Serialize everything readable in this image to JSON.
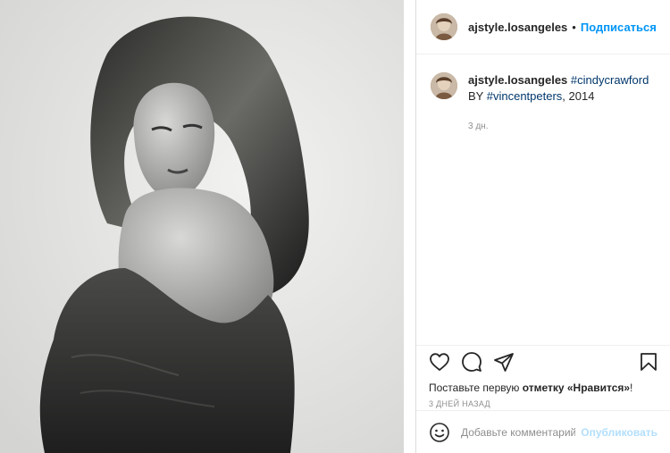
{
  "post": {
    "username": "ajstyle.losangeles",
    "follow_label": "Подписаться",
    "dot": "•"
  },
  "caption": {
    "username": "ajstyle.losangeles",
    "hashtag1": "#cindycrawford",
    "by_text": " BY",
    "hashtag2": "#vincentpeters",
    "year_text": ", 2014",
    "time": "3 дн."
  },
  "actions": {
    "icons": [
      "heart-icon",
      "comment-icon",
      "share-icon",
      "save-icon"
    ]
  },
  "likes": {
    "prefix": "Поставьте первую ",
    "bold": "отметку «Нравится»",
    "suffix": "!"
  },
  "date_text": "3 ДНЕЙ НАЗАД",
  "comment": {
    "placeholder": "Добавьте комментарий...",
    "publish_label": "Опубликовать"
  },
  "colors": {
    "accent": "#0095f6",
    "hashtag": "#00376b",
    "publish_disabled": "#b2dffc",
    "muted": "#8e8e8e"
  }
}
